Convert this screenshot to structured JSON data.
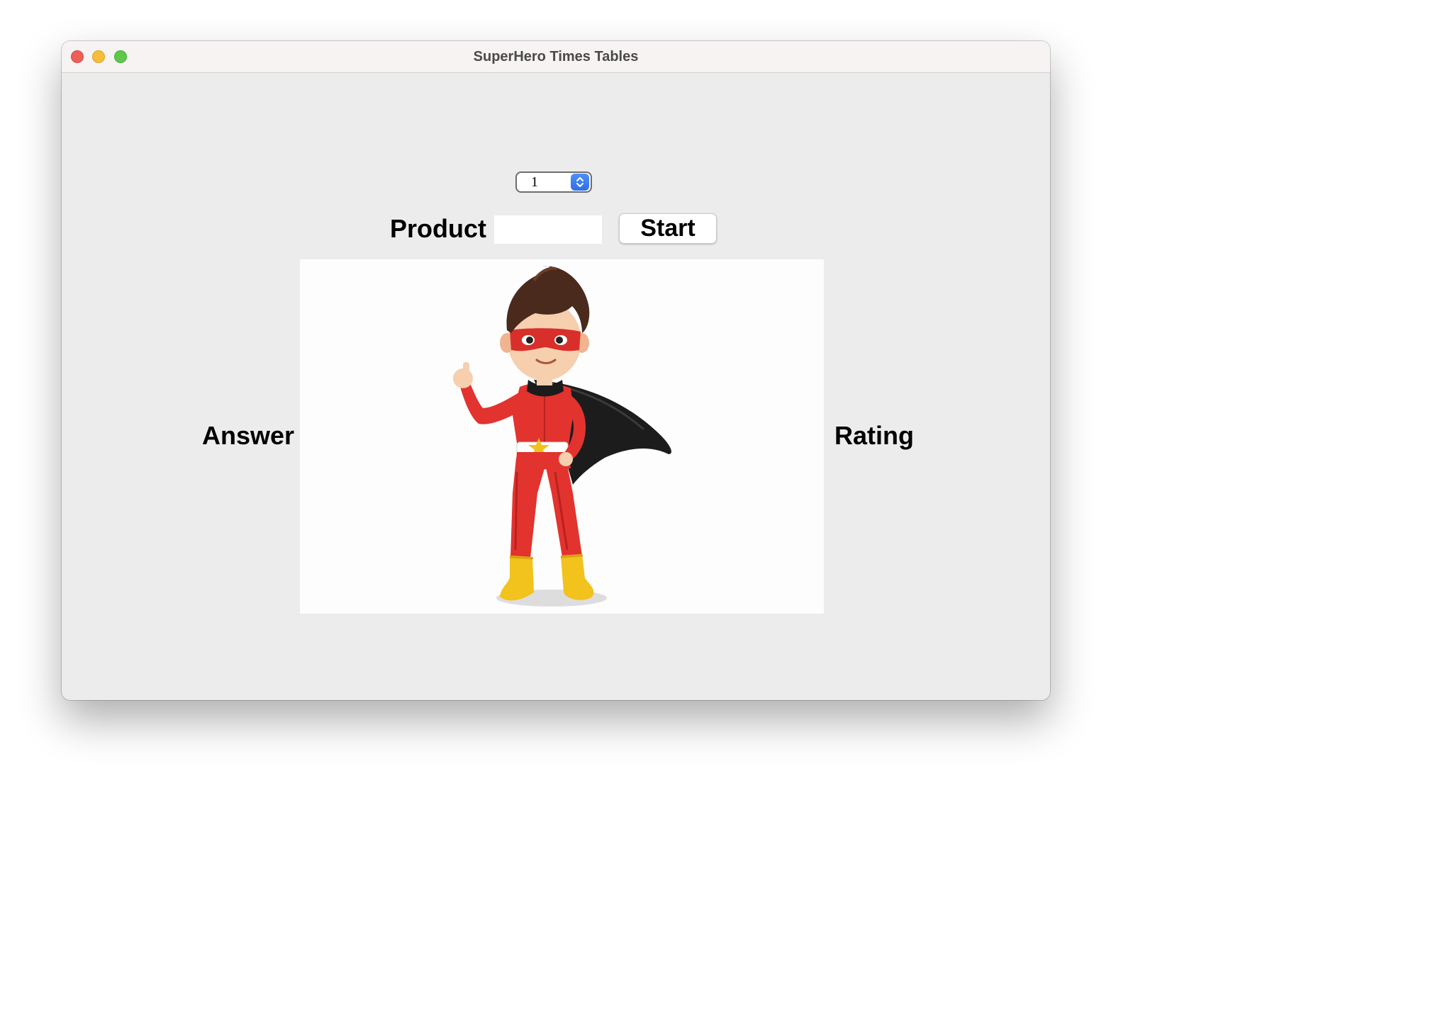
{
  "window": {
    "title": "SuperHero Times Tables"
  },
  "controls": {
    "table_stepper_value": "1",
    "product_label": "Product",
    "product_value": "",
    "start_label": "Start"
  },
  "labels": {
    "answer": "Answer",
    "rating": "Rating"
  },
  "image": {
    "subject": "superhero-boy",
    "colors": {
      "suit": "#e2332f",
      "mask": "#d92f2b",
      "cape": "#1c1c1c",
      "boots": "#f2c21d",
      "hair": "#4a2a1c",
      "skin": "#f6cfae"
    }
  },
  "colors": {
    "window_bg": "#ececec",
    "titlebar_bg": "#f6f3f2",
    "stepper_accent": "#3a7cf0"
  }
}
